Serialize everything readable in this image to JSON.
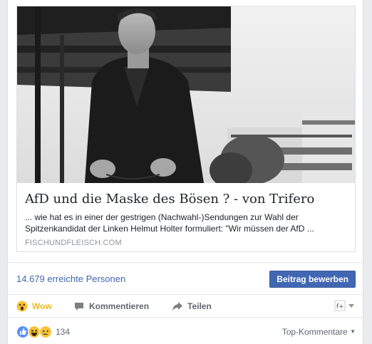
{
  "link_preview": {
    "title": "AfD und die Maske des Bösen ? - von Trifero",
    "description": "... wie hat es in einer der gestrigen (Nachwahl-)Sendungen zur Wahl der Spitzenkandidat der Linken Helmut Holter formuliert: \"Wir müssen der AfD ...",
    "domain": "FISCHUNDFLEISCH.COM",
    "image": "black-and-white-photo-man-in-dark-shirt"
  },
  "stats": {
    "reach_text": "14.679 erreichte Personen",
    "promote_label": "Beitrag bewerben"
  },
  "actions": {
    "wow_label": "Wow",
    "comment_label": "Kommentieren",
    "share_label": "Teilen"
  },
  "reactions": {
    "count": "134",
    "types": [
      "like",
      "haha",
      "sad"
    ],
    "top_comments_label": "Top-Kommentare"
  },
  "colors": {
    "link_blue": "#4267b2",
    "wow_yellow": "#f0ba15",
    "grey_text": "#606770"
  }
}
